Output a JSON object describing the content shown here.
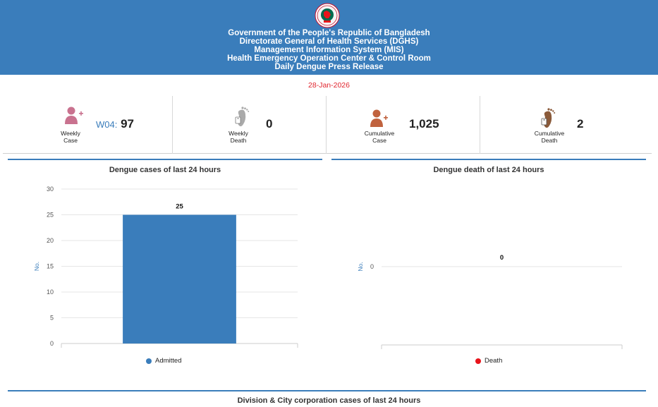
{
  "header": {
    "lines": [
      "Government of the People's Republic of Bangladesh",
      "Directorate General of Health Services (DGHS)",
      "Management Information System (MIS)",
      "Health Emergency Operation Center & Control Room",
      "Daily Dengue Press Release"
    ],
    "background": "#3a7dbb"
  },
  "date": "28-Jan-2026",
  "stats": [
    {
      "label_line1": "Weekly",
      "label_line2": "Case",
      "prefix": "W04:",
      "value": "97",
      "icon": "person-plus-icon",
      "icon_color": "#c9728f"
    },
    {
      "label_line1": "Weekly",
      "label_line2": "Death",
      "prefix": "",
      "value": "0",
      "icon": "footprint-tag-icon",
      "icon_color": "#aaaaaa"
    },
    {
      "label_line1": "Cumulative",
      "label_line2": "Case",
      "prefix": "",
      "value": "1,025",
      "icon": "person-plus-icon",
      "icon_color": "#c0623e"
    },
    {
      "label_line1": "Cumulative",
      "label_line2": "Death",
      "prefix": "",
      "value": "2",
      "icon": "footprint-tag-icon",
      "icon_color": "#8a5a3a"
    }
  ],
  "charts": {
    "cases_title": "Dengue cases of last 24 hours",
    "death_title": "Dengue death of last 24 hours",
    "bottom_title": "Division & City corporation cases of last 24 hours"
  },
  "chart_data": [
    {
      "type": "bar",
      "title": "Dengue cases of last 24 hours",
      "categories": [
        ""
      ],
      "series": [
        {
          "name": "Admitted",
          "values": [
            25
          ],
          "color": "#3a7dbb"
        }
      ],
      "ylabel": "No.",
      "ylim": [
        0,
        30
      ],
      "yticks": [
        "0",
        "5",
        "10",
        "15",
        "20",
        "25",
        "30"
      ],
      "data_labels": [
        "25"
      ],
      "grid": true,
      "legend": "bottom"
    },
    {
      "type": "bar",
      "title": "Dengue death of last 24 hours",
      "categories": [
        ""
      ],
      "series": [
        {
          "name": "Death",
          "values": [
            0
          ],
          "color": "#e8141b"
        }
      ],
      "ylabel": "No.",
      "yticks": [
        "0"
      ],
      "data_labels": [
        "0"
      ],
      "grid": true,
      "legend": "bottom"
    }
  ]
}
